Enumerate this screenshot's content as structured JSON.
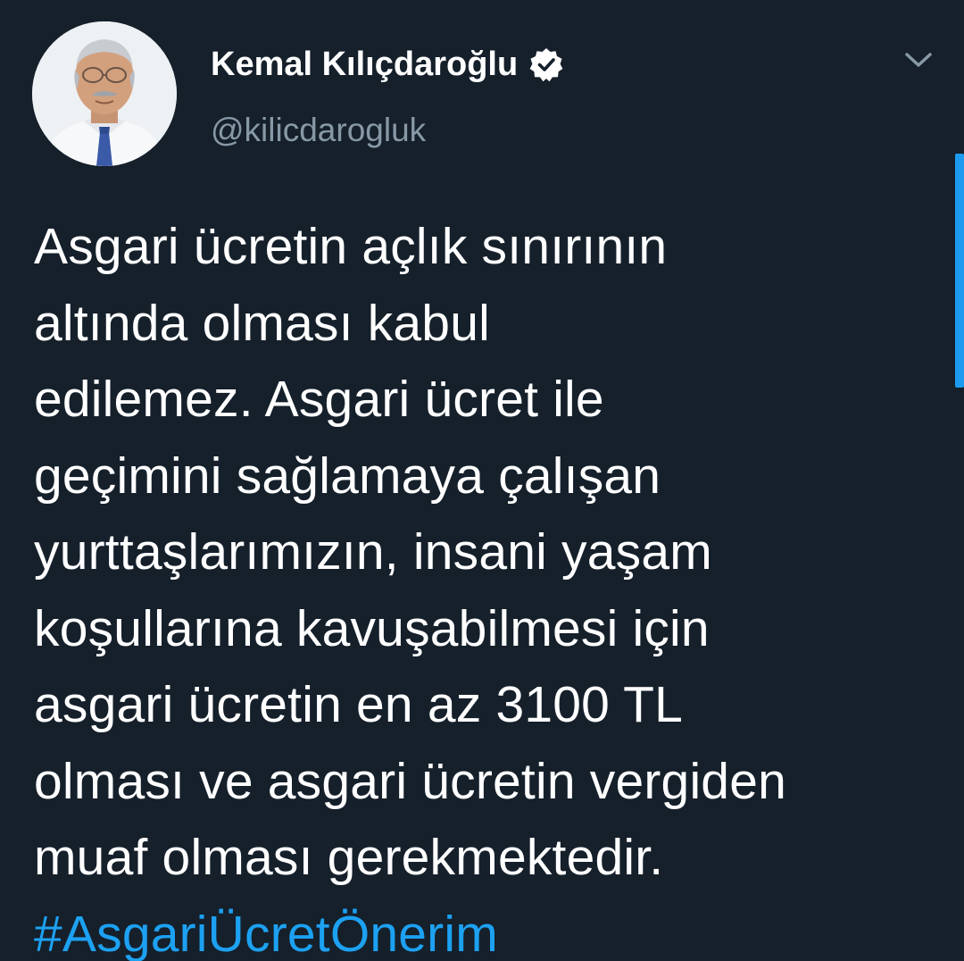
{
  "author": {
    "display_name": "Kemal Kılıçdaroğlu",
    "handle": "@kilicdarogluk",
    "verified": true,
    "avatar_icon": "profile-photo"
  },
  "tweet": {
    "lines": [
      "Asgari ücretin açlık sınırının",
      "altında olması kabul",
      "edilemez. Asgari ücret ile",
      "geçimini sağlamaya çalışan",
      "yurttaşlarımızın, insani yaşam",
      "koşullarına kavuşabilmesi için",
      "asgari ücretin en az 3100 TL",
      "olması ve asgari ücretin vergiden",
      "muaf olması gerekmektedir."
    ],
    "hashtag": "#AsgariÜcretÖnerim"
  },
  "menu": {
    "caret_icon": "chevron-down-icon"
  },
  "colors": {
    "background": "#15202b",
    "text": "#ffffff",
    "secondary_text": "#8899a6",
    "link": "#1da1f2"
  }
}
